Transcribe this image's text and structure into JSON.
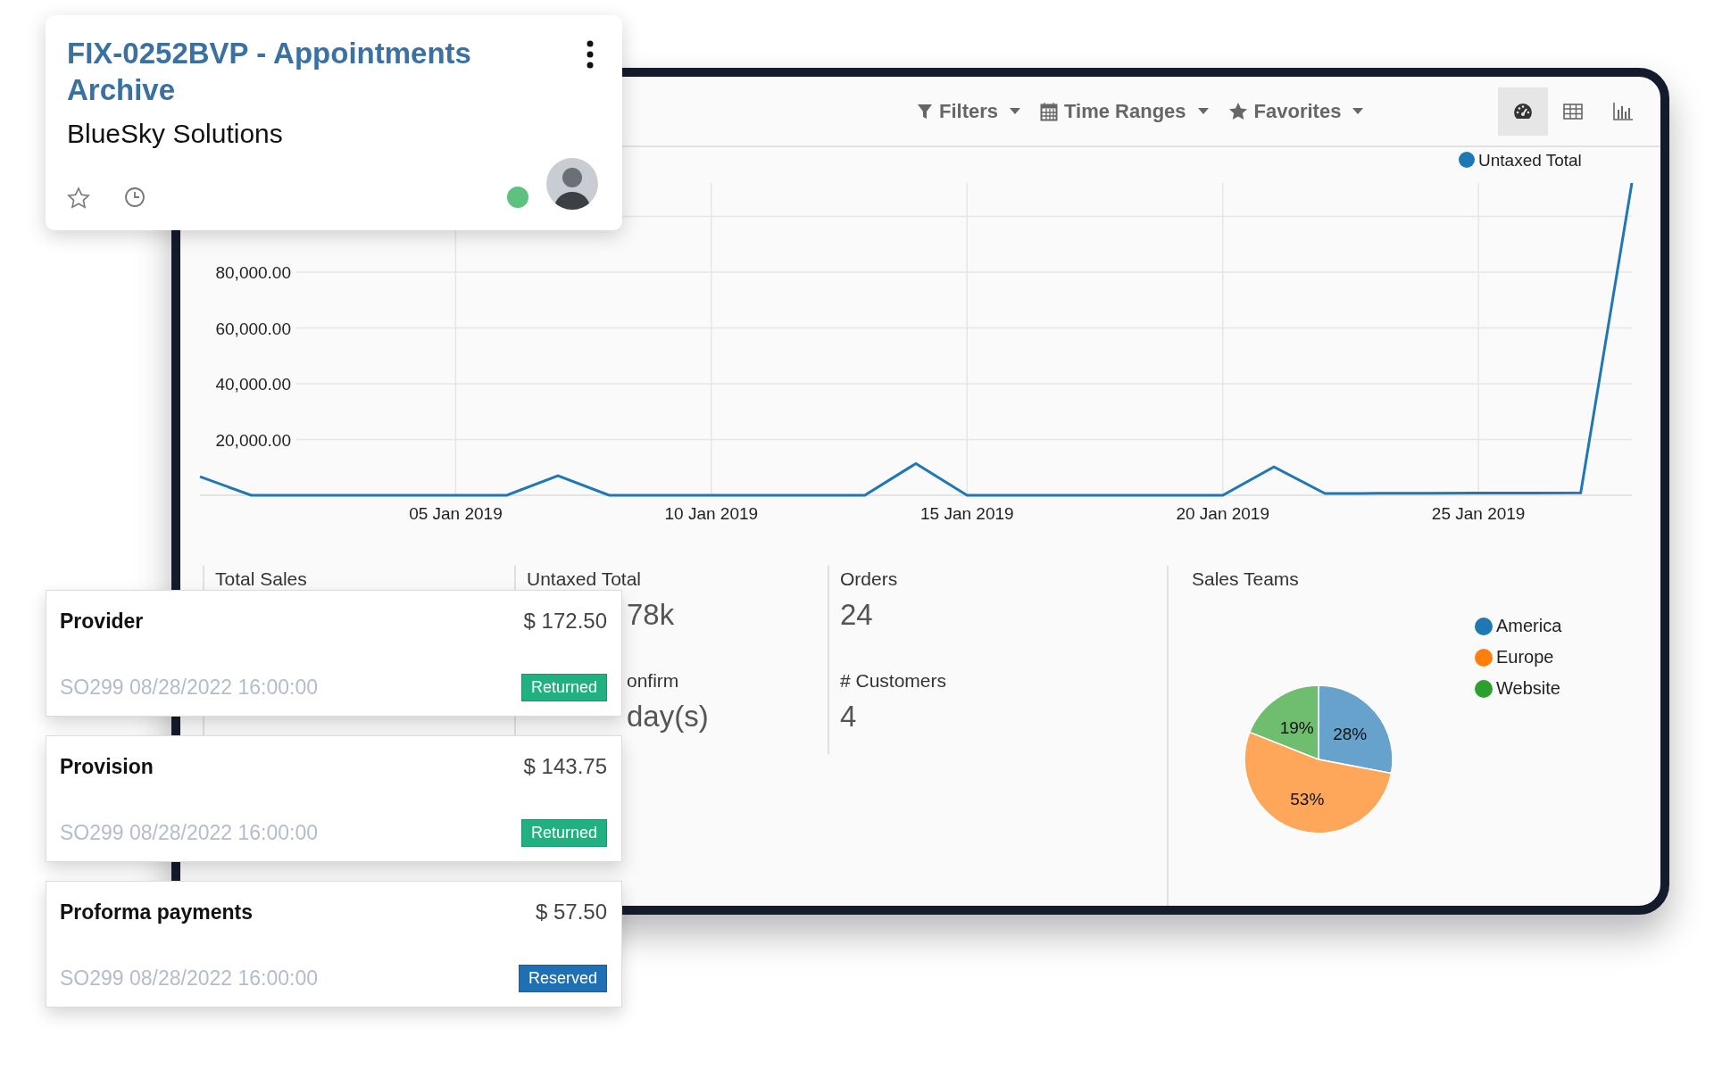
{
  "appointment_card": {
    "title": "FIX-0252BVP - Appointments Archive",
    "customer": "BlueSky Solutions",
    "starred": false,
    "ready": true
  },
  "toolbar": {
    "filters": [
      {
        "label": "Filters",
        "kind": "filter"
      },
      {
        "label": "Time Ranges",
        "kind": "calendar"
      },
      {
        "label": "Favorites",
        "kind": "star"
      }
    ],
    "views": [
      {
        "kind": "dashboard",
        "selected": true
      },
      {
        "kind": "grid",
        "selected": false
      },
      {
        "kind": "graph",
        "selected": false
      }
    ]
  },
  "line_chart": {
    "chart_data": {
      "type": "line",
      "categories": [
        null,
        null,
        null,
        null,
        null,
        "05 Jan 2019",
        null,
        null,
        null,
        null,
        "10 Jan 2019",
        null,
        null,
        null,
        null,
        "15 Jan 2019",
        null,
        null,
        null,
        null,
        "20 Jan 2019",
        null,
        null,
        null,
        null,
        "25 Jan 2019",
        null,
        null,
        null
      ],
      "grid": true,
      "ylim": [
        0,
        112000
      ],
      "yticks": [
        {
          "value": 20000,
          "label": "20,000.00"
        },
        {
          "value": 40000,
          "label": "40,000.00"
        },
        {
          "value": 60000,
          "label": "60,000.00"
        },
        {
          "value": 80000,
          "label": "80,000.00"
        }
      ],
      "series": [
        {
          "name": "Untaxed Total",
          "color": "#1f77b4",
          "values": [
            6700,
            0,
            0,
            0,
            0,
            0,
            0,
            7000,
            0,
            0,
            0,
            0,
            0,
            0,
            11400,
            0,
            0,
            0,
            0,
            0,
            0,
            10200,
            600,
            700,
            700,
            800,
            800,
            900,
            112000
          ]
        }
      ]
    }
  },
  "kpis": [
    {
      "cells": [
        {
          "title": "Total Sales"
        }
      ]
    },
    {
      "cells": [
        {
          "title": "Untaxed Total",
          "value": "78k"
        },
        {
          "title": "onfirm",
          "value": "day(s)"
        }
      ]
    },
    {
      "cells": [
        {
          "title": "Orders",
          "value": "24"
        },
        {
          "title": "# Customers",
          "value": "4"
        }
      ]
    }
  ],
  "sales_teams": {
    "title": "Sales Teams",
    "legend": [
      {
        "label": "America",
        "color": "#1f77b4"
      },
      {
        "label": "Europe",
        "color": "#ff7f0e"
      },
      {
        "label": "Website",
        "color": "#2ca02c"
      }
    ],
    "chart_data": {
      "type": "pie",
      "values": [
        28,
        53,
        19
      ],
      "value_labels": [
        "28%",
        "53%",
        "19%"
      ]
    }
  },
  "orders": [
    {
      "title": "Provider",
      "amount": "$ 172.50",
      "reference": "SO299 08/28/2022 16:00:00",
      "status": "Returned",
      "color": "#21b07f"
    },
    {
      "title": "Provision",
      "amount": "$ 143.75",
      "reference": "SO299 08/28/2022 16:00:00",
      "status": "Returned",
      "color": "#21b07f"
    },
    {
      "title": "Proforma payments",
      "amount": "$ 57.50",
      "reference": "SO299 08/28/2022 16:00:00",
      "status": "Reserved",
      "color": "#1f6fb5"
    }
  ]
}
